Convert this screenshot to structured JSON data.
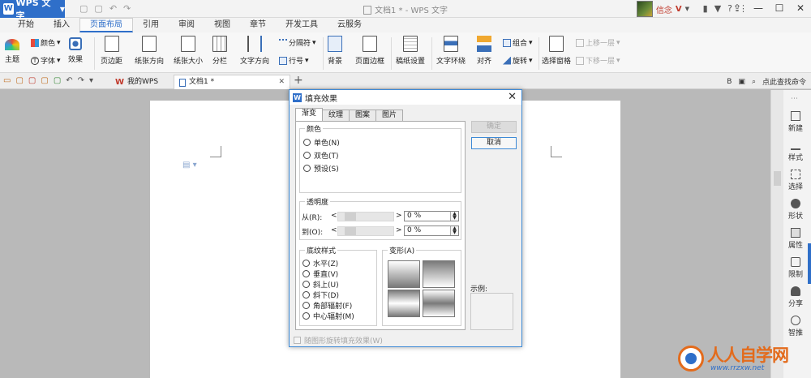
{
  "titlebar": {
    "app_label": "WPS 文字",
    "app_logo": "W",
    "doc_title": "文档1 * - WPS 文字",
    "user_name": "信念",
    "user_badge": "V",
    "ctrl_min": "—",
    "ctrl_max": "☐",
    "ctrl_close": "✕"
  },
  "menu": {
    "tabs": [
      "开始",
      "插入",
      "页面布局",
      "引用",
      "审阅",
      "视图",
      "章节",
      "开发工具",
      "云服务"
    ],
    "active": "页面布局"
  },
  "ribbon": {
    "theme": "主题",
    "color": "颜色",
    "font": "字体",
    "effect": "效果",
    "margin": "页边距",
    "orientation": "纸张方向",
    "size": "纸张大小",
    "columns": "分栏",
    "text_direction": "文字方向",
    "separator": "分隔符",
    "line_numbers": "行号",
    "background": "背景",
    "page_border": "页面边框",
    "grid_setup": "稿纸设置",
    "wrap_text": "文字环绕",
    "align": "对齐",
    "group": "组合",
    "rotate": "旋转",
    "selection_pane": "选择窗格",
    "bring_forward": "上移一层",
    "send_backward": "下移一层"
  },
  "tabstrip": {
    "tab1": "我的WPS",
    "tab1_logo": "W",
    "tab2": "文档1 *",
    "close": "✕",
    "add": "+",
    "search": "点此查找命令"
  },
  "sidebar": {
    "items": [
      "新建",
      "样式",
      "选择",
      "形状",
      "属性",
      "限制",
      "分享",
      "智推"
    ]
  },
  "dialog": {
    "title": "填充效果",
    "logo": "W",
    "close": "✕",
    "tabs": [
      "渐变",
      "纹理",
      "图案",
      "图片"
    ],
    "color_group": "颜色",
    "color_options": [
      "单色(N)",
      "双色(T)",
      "预设(S)"
    ],
    "transparency_group": "透明度",
    "from_label": "从(R):",
    "to_label": "到(O):",
    "from_value": "0 %",
    "to_value": "0 %",
    "arrow_left": "<",
    "arrow_right": ">",
    "shading_group": "底纹样式",
    "shading_options": [
      "水平(Z)",
      "垂直(V)",
      "斜上(U)",
      "斜下(D)",
      "角部辐射(F)",
      "中心辐射(M)"
    ],
    "variants_group": "变形(A)",
    "ok": "确定",
    "cancel": "取消",
    "sample": "示例:",
    "rotate_check": "随图形旋转填充效果(W)"
  },
  "watermark": {
    "text": "人人自学网",
    "url": "www.rrzxw.net"
  }
}
